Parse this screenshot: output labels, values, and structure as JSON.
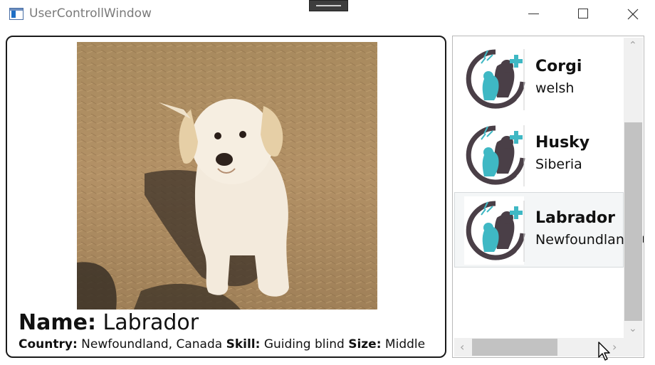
{
  "window": {
    "title": "UserControllWindow",
    "icons": [
      "app-window-icon",
      "minimize-icon",
      "maximize-icon",
      "close-icon"
    ]
  },
  "detail": {
    "name_label": "Name:",
    "name_value": "Labrador",
    "country_label": "Country:",
    "country_value": "Newfoundland, Canada",
    "skill_label": "Skill:",
    "skill_value": "Guiding blind",
    "size_label": "Size:",
    "size_value": "Middle",
    "photo": "puppy-photo"
  },
  "dog_list": {
    "items": [
      {
        "name": "Corgi",
        "country": "welsh",
        "icon": "pet-logo-icon",
        "selected": false
      },
      {
        "name": "Husky",
        "country": "Siberia",
        "icon": "pet-logo-icon",
        "selected": false
      },
      {
        "name": "Labrador",
        "country": "Newfoundland, Canada",
        "icon": "pet-logo-icon",
        "selected": true
      }
    ]
  },
  "colors": {
    "logo_dark": "#4a3f47",
    "logo_teal": "#3fb8c4",
    "selection_bg": "#f4f6f7",
    "scrollbar_thumb": "#c2c2c2"
  }
}
